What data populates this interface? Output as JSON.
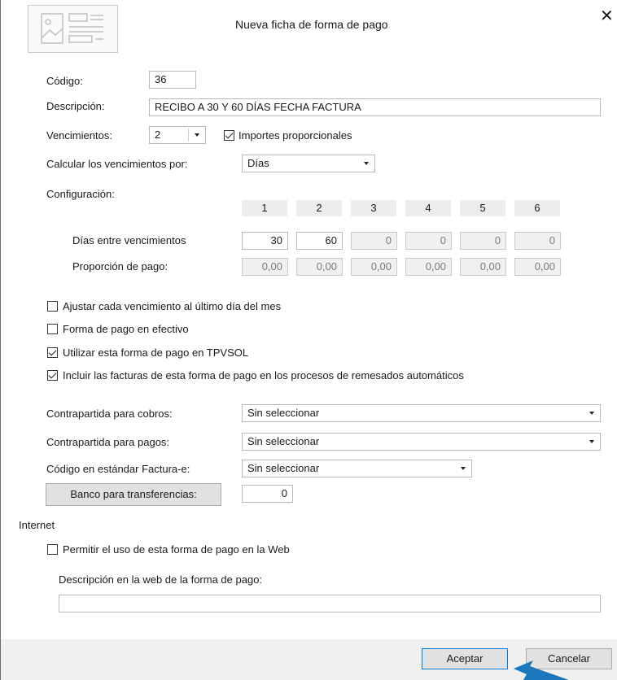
{
  "dialog": {
    "title": "Nueva ficha de forma de pago",
    "close_label": "✕"
  },
  "fields": {
    "codigo": {
      "label": "Código:",
      "value": "36"
    },
    "descripcion": {
      "label": "Descripción:",
      "value": "RECIBO A 30 Y 60 DÍAS FECHA FACTURA"
    },
    "vencimientos": {
      "label": "Vencimientos:",
      "value": "2"
    },
    "importes_proporcionales": {
      "label": "Importes proporcionales",
      "checked": true
    },
    "calcular": {
      "label": "Calcular los vencimientos por:",
      "value": "Días"
    }
  },
  "config": {
    "label": "Configuración:",
    "columns": [
      "1",
      "2",
      "3",
      "4",
      "5",
      "6"
    ],
    "rows": [
      {
        "label": "Días entre vencimientos",
        "values": [
          "30",
          "60",
          "0",
          "0",
          "0",
          "0"
        ]
      },
      {
        "label": "Proporción de pago:",
        "values": [
          "0,00",
          "0,00",
          "0,00",
          "0,00",
          "0,00",
          "0,00"
        ]
      }
    ]
  },
  "options": [
    {
      "label": "Ajustar cada vencimiento al último día del mes",
      "checked": false
    },
    {
      "label": "Forma de pago en efectivo",
      "checked": false
    },
    {
      "label": "Utilizar esta forma de pago en TPVSOL",
      "checked": true
    },
    {
      "label": "Incluir las facturas de esta forma de pago en los procesos de remesados automáticos",
      "checked": true
    }
  ],
  "accounts": {
    "cobros": {
      "label": "Contrapartida para cobros:",
      "value": "Sin seleccionar"
    },
    "pagos": {
      "label": "Contrapartida para pagos:",
      "value": "Sin seleccionar"
    },
    "factura_e": {
      "label": "Código en estándar Factura-e:",
      "value": "Sin seleccionar"
    },
    "banco": {
      "button_label": "Banco para transferencias:",
      "value": "0"
    }
  },
  "internet": {
    "section_label": "Internet",
    "permitir": {
      "label": "Permitir el uso de esta forma de pago en la Web",
      "checked": false
    },
    "descripcion_web": {
      "label": "Descripción en la web de la forma de pago:",
      "value": ""
    }
  },
  "buttons": {
    "accept": "Aceptar",
    "cancel": "Cancelar"
  }
}
